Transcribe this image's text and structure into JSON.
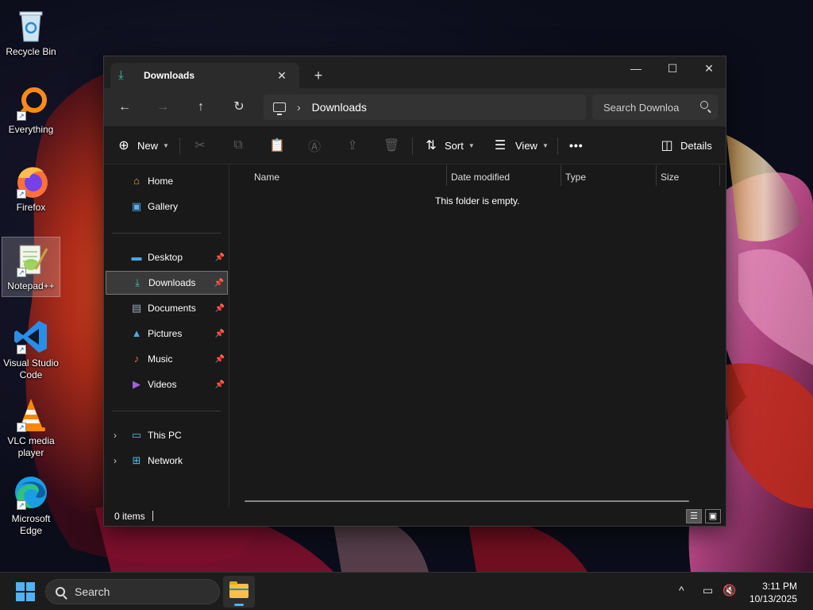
{
  "desktop": {
    "icons": [
      {
        "label": "Recycle Bin",
        "icon": "recycle-bin-icon",
        "shortcut": false
      },
      {
        "label": "Everything",
        "icon": "everything-icon",
        "shortcut": true
      },
      {
        "label": "Firefox",
        "icon": "firefox-icon",
        "shortcut": true
      },
      {
        "label": "Notepad++",
        "icon": "notepadpp-icon",
        "shortcut": true,
        "selected": true
      },
      {
        "label": "Visual Studio Code",
        "line1": "Visual Studio",
        "line2": "Code",
        "icon": "vscode-icon",
        "shortcut": true
      },
      {
        "label": "VLC media player",
        "line1": "VLC media",
        "line2": "player",
        "icon": "vlc-icon",
        "shortcut": true
      },
      {
        "label": "Microsoft Edge",
        "line1": "Microsoft",
        "line2": "Edge",
        "icon": "edge-icon",
        "shortcut": true
      }
    ]
  },
  "explorer": {
    "tab_title": "Downloads",
    "address": {
      "crumb": "Downloads"
    },
    "search_placeholder": "Search Downloa",
    "toolbar": {
      "new_label": "New",
      "sort_label": "Sort",
      "view_label": "View",
      "more_label": "•••",
      "details_label": "Details"
    },
    "sidebar": {
      "items": [
        {
          "label": "Home",
          "icon": "home-icon"
        },
        {
          "label": "Gallery",
          "icon": "gallery-icon"
        },
        {
          "label": "Desktop",
          "icon": "desktop-icon",
          "pinned": true
        },
        {
          "label": "Downloads",
          "icon": "downloads-icon",
          "pinned": true,
          "active": true
        },
        {
          "label": "Documents",
          "icon": "documents-icon",
          "pinned": true
        },
        {
          "label": "Pictures",
          "icon": "pictures-icon",
          "pinned": true
        },
        {
          "label": "Music",
          "icon": "music-icon",
          "pinned": true
        },
        {
          "label": "Videos",
          "icon": "videos-icon",
          "pinned": true
        },
        {
          "label": "This PC",
          "icon": "this-pc-icon",
          "expandable": true
        },
        {
          "label": "Network",
          "icon": "network-icon",
          "expandable": true
        }
      ]
    },
    "columns": [
      "Name",
      "Date modified",
      "Type",
      "Size"
    ],
    "empty_message": "This folder is empty.",
    "status": {
      "item_count": "0 items"
    }
  },
  "taskbar": {
    "search_placeholder": "Search",
    "clock": {
      "time": "3:11 PM",
      "date": "10/13/2025"
    }
  },
  "colors": {
    "accent": "#4fb3f6",
    "downloads_icon": "#3ac8b0",
    "folder": "#f6c244"
  }
}
